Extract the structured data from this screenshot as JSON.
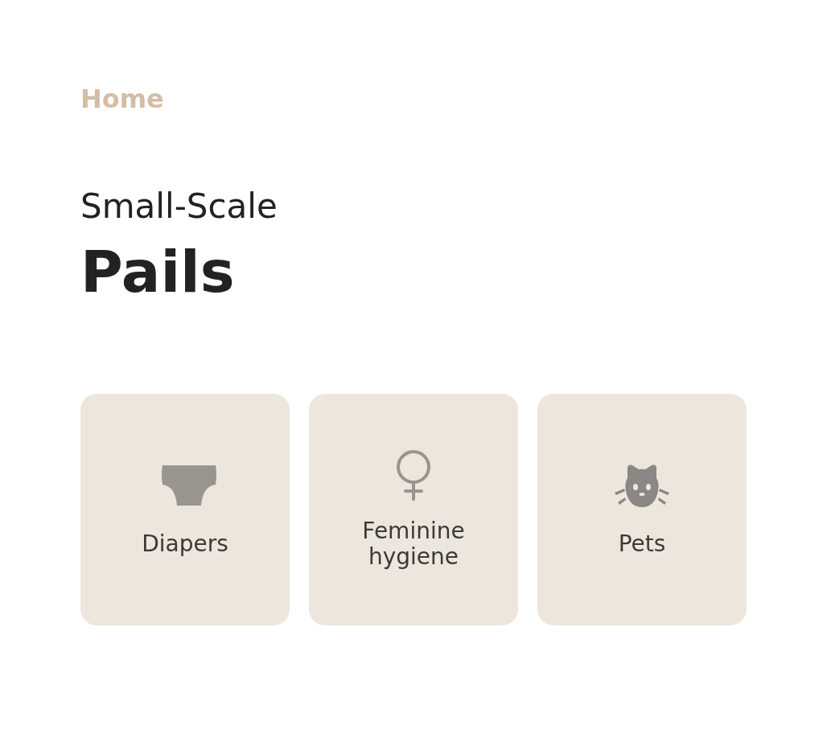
{
  "breadcrumb": {
    "label": "Home"
  },
  "heading": {
    "subtitle": "Small-Scale",
    "title": "Pails"
  },
  "categories": [
    {
      "label": "Diapers"
    },
    {
      "label": "Feminine hygiene"
    },
    {
      "label": "Pets"
    }
  ]
}
